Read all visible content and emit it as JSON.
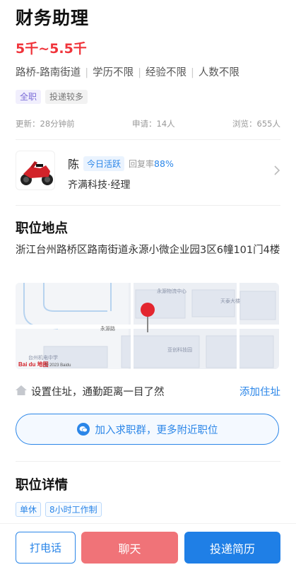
{
  "job": {
    "title": "财务助理",
    "salary": "5千~5.5千",
    "meta": [
      "路桥-路南街道",
      "学历不限",
      "经验不限",
      "人数不限"
    ],
    "tags": [
      "全职",
      "投递较多"
    ]
  },
  "stats": {
    "updated": "更新：28分钟前",
    "applied": "申请：14人",
    "views": "浏览：655人"
  },
  "recruiter": {
    "name": "陈",
    "active_badge": "今日活跃",
    "reply_label": "回复率",
    "reply_rate": "88%",
    "company": "齐满科技·经理"
  },
  "location": {
    "heading": "职位地点",
    "address": "浙江台州路桥区路南街道永源小微企业园3区6幢101门4楼",
    "map_labels": {
      "road": "永源路",
      "place_a": "永源物流中心",
      "place_b": "天泰大楼",
      "place_c": "亚创科技园",
      "place_d": "台州机电中学",
      "baidu": "Bai du 地图",
      "copyright": "© 2023 Baidu"
    }
  },
  "commute": {
    "text": "设置住址，通勤距离一目了然",
    "action": "添加住址"
  },
  "group_banner": {
    "text": "加入求职群，更多附近职位"
  },
  "details": {
    "heading": "职位详情",
    "tags": [
      "单休",
      "8小时工作制"
    ]
  },
  "bottom": {
    "call": "打电话",
    "chat": "聊天",
    "apply": "投递简历"
  },
  "colors": {
    "accent_blue": "#2b86e8",
    "salary_red": "#f0343b",
    "chat_pink": "#f07378",
    "apply_blue": "#1f7fe6"
  },
  "icons": [
    "motorcycle-avatar",
    "chevron-right-icon",
    "home-icon",
    "wechat-icon",
    "map-pin-icon"
  ]
}
